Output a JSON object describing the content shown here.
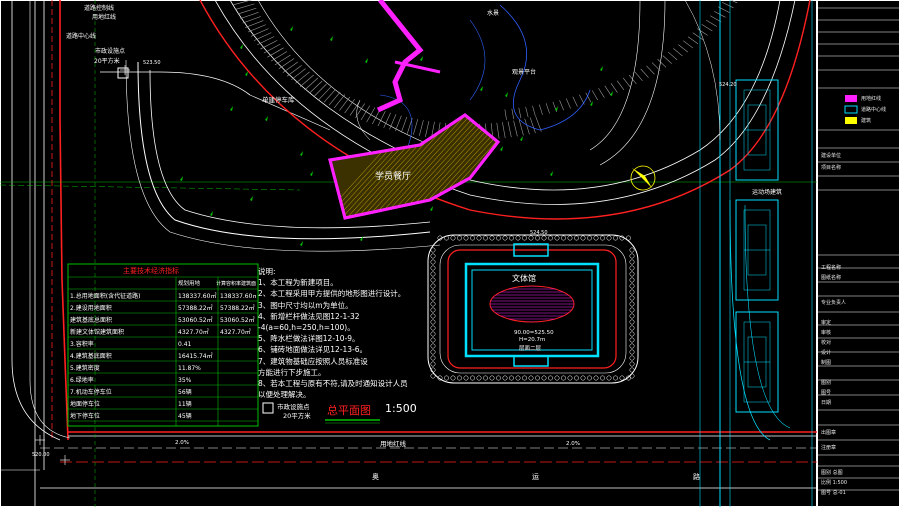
{
  "labels": {
    "road_control": "道路控制线",
    "land_red_line": "用地红线",
    "road_center": "道路中心线",
    "utility_point_top": "市政设施点",
    "utility_area_top": "20平方米",
    "utility_point_bottom": "市政设施点",
    "utility_area_bottom": "20平方米",
    "parking": "单建停车库",
    "water": "水景",
    "dock": "观景平台",
    "hall": "学员餐厅",
    "culture": "文体馆",
    "culture_elev": "90.00=525.50",
    "culture_h": "H=20.7m",
    "culture_sub": "层面二层",
    "sports": "运动场建筑",
    "title_plan": "总平面图",
    "scale": "1:500",
    "boundary": "用地红线",
    "road_name": [
      "奥",
      "运",
      "路"
    ],
    "road_width_left": "2.0%",
    "road_width_right": "2.0%",
    "coords_left": "520.00",
    "coords_top": "523.50",
    "coord_mid": "524.50",
    "coord_right": "524.20",
    "block": "A"
  },
  "table": {
    "title": "主要技术经济指标",
    "headers": [
      "",
      "规划用地",
      "计算容积率建筑面积"
    ],
    "rows": [
      [
        "1.总用地面积(含代征道路)",
        "138337.60㎡",
        "138337.60㎡"
      ],
      [
        "2.建设用地面积",
        "57388.22㎡",
        "57388.22㎡"
      ],
      [
        "  建筑基底总面积",
        "53060.52㎡",
        "53060.52㎡"
      ],
      [
        "  新建文体馆建筑面积",
        "4327.70㎡",
        "4327.70㎡"
      ],
      [
        "3.容积率",
        "0.41",
        ""
      ],
      [
        "4.建筑基底面积",
        "16415.74㎡",
        ""
      ],
      [
        "5.建筑密度",
        "11.87%",
        ""
      ],
      [
        "6.绿地率",
        "35%",
        ""
      ],
      [
        "7.机动车停车位",
        "56辆",
        ""
      ],
      [
        "  地面停车位",
        "11辆",
        ""
      ],
      [
        "  地下停车位",
        "45辆",
        ""
      ]
    ]
  },
  "notes": {
    "title": "说明:",
    "lines": [
      "1、本工程为新建项目。",
      "2、本工程采用甲方提供的地形图进行设计。",
      "3、图中尺寸均以m为单位。",
      "4、新增栏杆做法见图12-1-32",
      "-4(a=60,h=250,h=100)。",
      "5、降水栏做法详图12-10-9。",
      "6、铺砖地面做法详见12-13-6。",
      "7、建筑物基础应按照人员标准设",
      "方能进行下步施工。",
      "8、若本工程与原有不符,请及时通知设计人员",
      "以便处理解决。"
    ]
  },
  "panel": {
    "items": [
      "建设单位",
      "项目名称",
      "工程名称",
      "图纸名称",
      "专业负责人",
      "审定",
      "审核",
      "校对",
      "设计",
      "制图",
      "图别",
      "图号",
      "日期",
      "出图章",
      "注册章"
    ],
    "legend": [
      "用地红线",
      "道路中心线",
      "建筑"
    ],
    "bottom": [
      "图别 总图",
      "比例 1:500",
      "图号 总-01"
    ]
  },
  "colors": {
    "red": "#ff2020",
    "white": "#ffffff",
    "green": "#00c000",
    "cyan": "#00e0ff",
    "magenta": "#ff20ff",
    "yellow": "#ffff00",
    "blue": "#3060ff"
  }
}
